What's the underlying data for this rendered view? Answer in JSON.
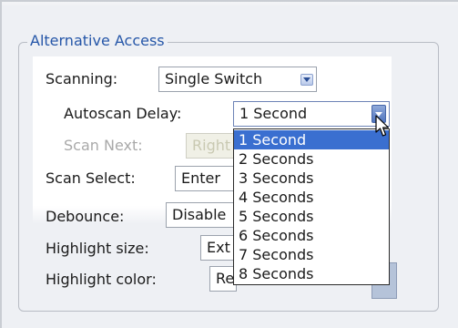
{
  "group": {
    "title": "Alternative Access"
  },
  "fields": {
    "scanning": {
      "label": "Scanning:",
      "value": "Single Switch"
    },
    "autoscan_delay": {
      "label": "Autoscan Delay:",
      "value": "1 Second"
    },
    "scan_next": {
      "label": "Scan Next:",
      "value": "Right"
    },
    "scan_select": {
      "label": "Scan Select:",
      "value": "Enter"
    },
    "debounce": {
      "label": "Debounce:",
      "value": "Disable"
    },
    "highlight_size": {
      "label": "Highlight size:",
      "value": "Ext"
    },
    "highlight_color": {
      "label": "Highlight color:",
      "value": "Re"
    }
  },
  "dropdown": {
    "options": [
      "1 Second",
      "2 Seconds",
      "3 Seconds",
      "4 Seconds",
      "5 Seconds",
      "6 Seconds",
      "7 Seconds",
      "8 Seconds"
    ],
    "selected_index": 0
  },
  "colors": {
    "title": "#2556a8",
    "selection": "#3a6fd0",
    "background": "#eef0f4"
  },
  "icons": {
    "combo_arrow": "chevron-down-icon",
    "pointer": "mouse-cursor-icon"
  }
}
